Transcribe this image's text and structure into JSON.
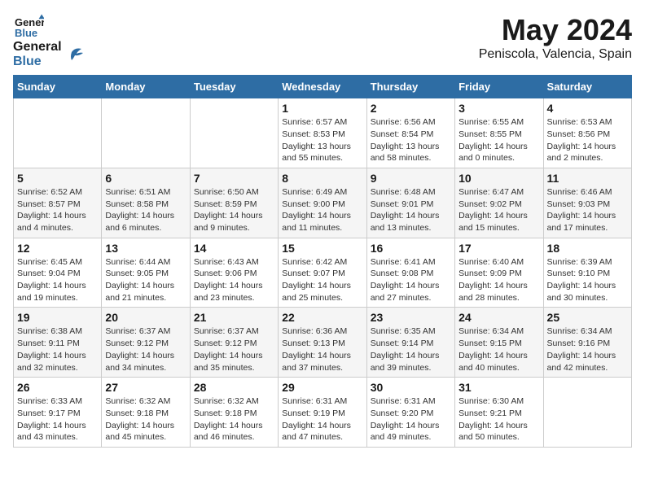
{
  "header": {
    "logo_line1": "General",
    "logo_line2": "Blue",
    "title": "May 2024",
    "subtitle": "Peniscola, Valencia, Spain"
  },
  "days_of_week": [
    "Sunday",
    "Monday",
    "Tuesday",
    "Wednesday",
    "Thursday",
    "Friday",
    "Saturday"
  ],
  "weeks": [
    [
      {
        "day": "",
        "info": ""
      },
      {
        "day": "",
        "info": ""
      },
      {
        "day": "",
        "info": ""
      },
      {
        "day": "1",
        "info": "Sunrise: 6:57 AM\nSunset: 8:53 PM\nDaylight: 13 hours\nand 55 minutes."
      },
      {
        "day": "2",
        "info": "Sunrise: 6:56 AM\nSunset: 8:54 PM\nDaylight: 13 hours\nand 58 minutes."
      },
      {
        "day": "3",
        "info": "Sunrise: 6:55 AM\nSunset: 8:55 PM\nDaylight: 14 hours\nand 0 minutes."
      },
      {
        "day": "4",
        "info": "Sunrise: 6:53 AM\nSunset: 8:56 PM\nDaylight: 14 hours\nand 2 minutes."
      }
    ],
    [
      {
        "day": "5",
        "info": "Sunrise: 6:52 AM\nSunset: 8:57 PM\nDaylight: 14 hours\nand 4 minutes."
      },
      {
        "day": "6",
        "info": "Sunrise: 6:51 AM\nSunset: 8:58 PM\nDaylight: 14 hours\nand 6 minutes."
      },
      {
        "day": "7",
        "info": "Sunrise: 6:50 AM\nSunset: 8:59 PM\nDaylight: 14 hours\nand 9 minutes."
      },
      {
        "day": "8",
        "info": "Sunrise: 6:49 AM\nSunset: 9:00 PM\nDaylight: 14 hours\nand 11 minutes."
      },
      {
        "day": "9",
        "info": "Sunrise: 6:48 AM\nSunset: 9:01 PM\nDaylight: 14 hours\nand 13 minutes."
      },
      {
        "day": "10",
        "info": "Sunrise: 6:47 AM\nSunset: 9:02 PM\nDaylight: 14 hours\nand 15 minutes."
      },
      {
        "day": "11",
        "info": "Sunrise: 6:46 AM\nSunset: 9:03 PM\nDaylight: 14 hours\nand 17 minutes."
      }
    ],
    [
      {
        "day": "12",
        "info": "Sunrise: 6:45 AM\nSunset: 9:04 PM\nDaylight: 14 hours\nand 19 minutes."
      },
      {
        "day": "13",
        "info": "Sunrise: 6:44 AM\nSunset: 9:05 PM\nDaylight: 14 hours\nand 21 minutes."
      },
      {
        "day": "14",
        "info": "Sunrise: 6:43 AM\nSunset: 9:06 PM\nDaylight: 14 hours\nand 23 minutes."
      },
      {
        "day": "15",
        "info": "Sunrise: 6:42 AM\nSunset: 9:07 PM\nDaylight: 14 hours\nand 25 minutes."
      },
      {
        "day": "16",
        "info": "Sunrise: 6:41 AM\nSunset: 9:08 PM\nDaylight: 14 hours\nand 27 minutes."
      },
      {
        "day": "17",
        "info": "Sunrise: 6:40 AM\nSunset: 9:09 PM\nDaylight: 14 hours\nand 28 minutes."
      },
      {
        "day": "18",
        "info": "Sunrise: 6:39 AM\nSunset: 9:10 PM\nDaylight: 14 hours\nand 30 minutes."
      }
    ],
    [
      {
        "day": "19",
        "info": "Sunrise: 6:38 AM\nSunset: 9:11 PM\nDaylight: 14 hours\nand 32 minutes."
      },
      {
        "day": "20",
        "info": "Sunrise: 6:37 AM\nSunset: 9:12 PM\nDaylight: 14 hours\nand 34 minutes."
      },
      {
        "day": "21",
        "info": "Sunrise: 6:37 AM\nSunset: 9:12 PM\nDaylight: 14 hours\nand 35 minutes."
      },
      {
        "day": "22",
        "info": "Sunrise: 6:36 AM\nSunset: 9:13 PM\nDaylight: 14 hours\nand 37 minutes."
      },
      {
        "day": "23",
        "info": "Sunrise: 6:35 AM\nSunset: 9:14 PM\nDaylight: 14 hours\nand 39 minutes."
      },
      {
        "day": "24",
        "info": "Sunrise: 6:34 AM\nSunset: 9:15 PM\nDaylight: 14 hours\nand 40 minutes."
      },
      {
        "day": "25",
        "info": "Sunrise: 6:34 AM\nSunset: 9:16 PM\nDaylight: 14 hours\nand 42 minutes."
      }
    ],
    [
      {
        "day": "26",
        "info": "Sunrise: 6:33 AM\nSunset: 9:17 PM\nDaylight: 14 hours\nand 43 minutes."
      },
      {
        "day": "27",
        "info": "Sunrise: 6:32 AM\nSunset: 9:18 PM\nDaylight: 14 hours\nand 45 minutes."
      },
      {
        "day": "28",
        "info": "Sunrise: 6:32 AM\nSunset: 9:18 PM\nDaylight: 14 hours\nand 46 minutes."
      },
      {
        "day": "29",
        "info": "Sunrise: 6:31 AM\nSunset: 9:19 PM\nDaylight: 14 hours\nand 47 minutes."
      },
      {
        "day": "30",
        "info": "Sunrise: 6:31 AM\nSunset: 9:20 PM\nDaylight: 14 hours\nand 49 minutes."
      },
      {
        "day": "31",
        "info": "Sunrise: 6:30 AM\nSunset: 9:21 PM\nDaylight: 14 hours\nand 50 minutes."
      },
      {
        "day": "",
        "info": ""
      }
    ]
  ]
}
